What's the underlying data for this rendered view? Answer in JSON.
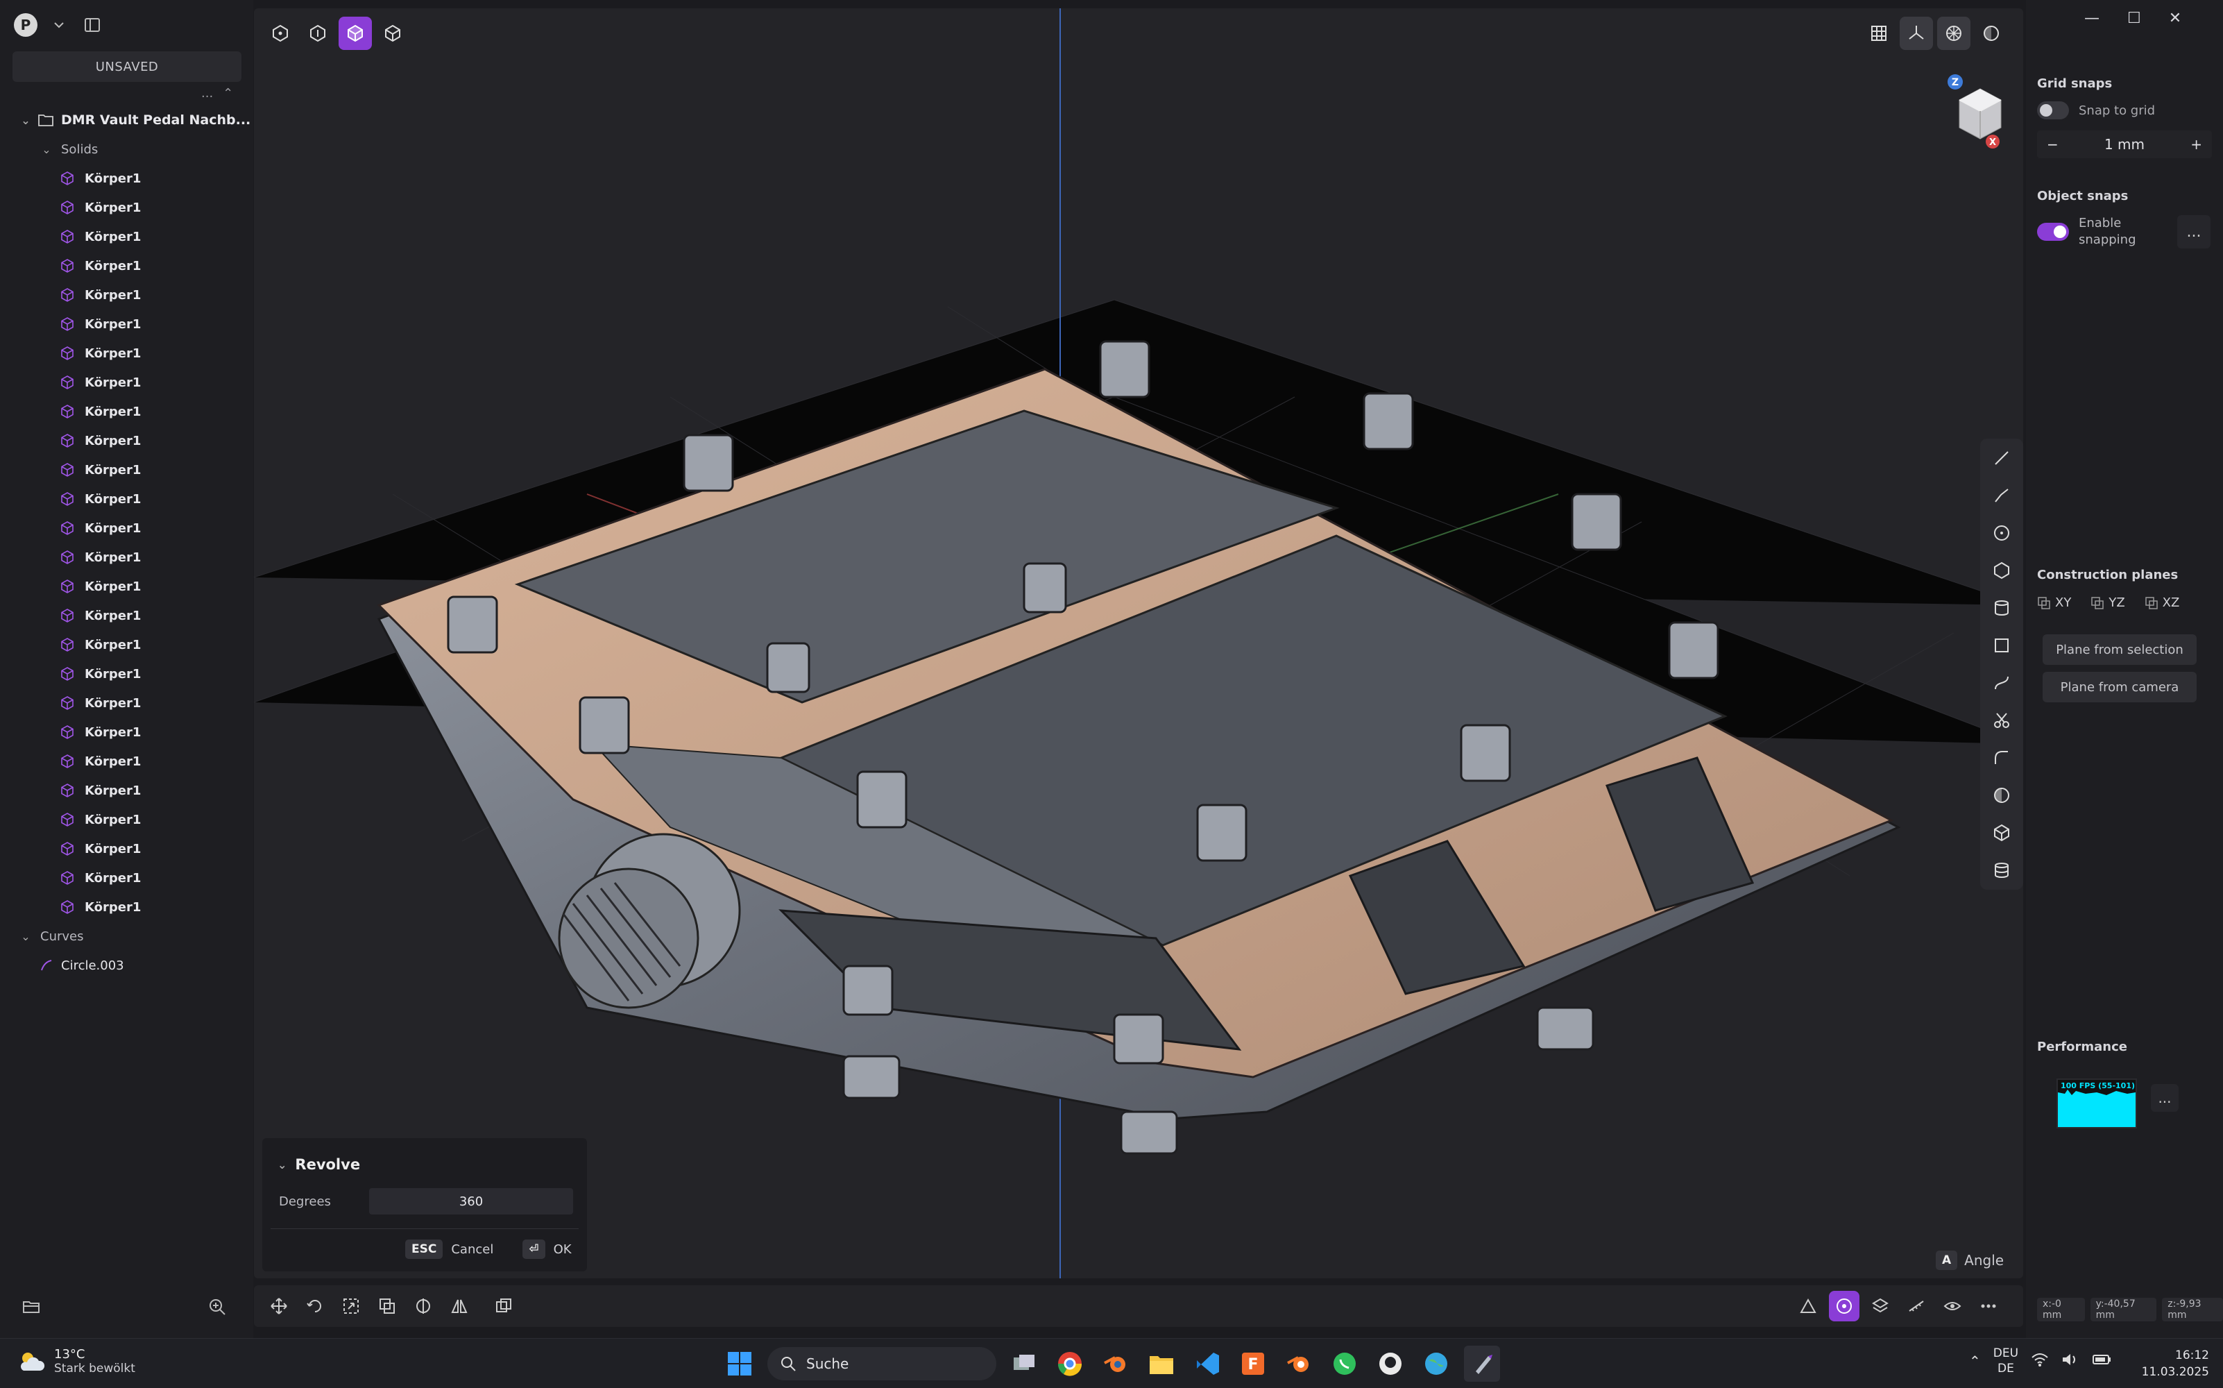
{
  "sidebar": {
    "avatar_letter": "P",
    "unsaved_label": "UNSAVED",
    "more_label": "...",
    "project_name": "DMR Vault Pedal Nachb...",
    "solids_label": "Solids",
    "solids": [
      "Körper1",
      "Körper1",
      "Körper1",
      "Körper1",
      "Körper1",
      "Körper1",
      "Körper1",
      "Körper1",
      "Körper1",
      "Körper1",
      "Körper1",
      "Körper1",
      "Körper1",
      "Körper1",
      "Körper1",
      "Körper1",
      "Körper1",
      "Körper1",
      "Körper1",
      "Körper1",
      "Körper1",
      "Körper1",
      "Körper1",
      "Körper1",
      "Körper1",
      "Körper1"
    ],
    "curves_label": "Curves",
    "curves": [
      "Circle.003"
    ]
  },
  "revolve": {
    "title": "Revolve",
    "degrees_label": "Degrees",
    "degrees_value": "360",
    "cancel_key": "ESC",
    "cancel_label": "Cancel",
    "ok_key": "⏎",
    "ok_label": "OK"
  },
  "angle": {
    "key": "A",
    "label": "Angle"
  },
  "right_panel": {
    "grid_snaps_title": "Grid snaps",
    "snap_to_grid_label": "Snap to grid",
    "snap_to_grid_on": false,
    "grid_size_value": "1 mm",
    "minus_label": "−",
    "plus_label": "+",
    "object_snaps_title": "Object snaps",
    "enable_snapping_label_1": "Enable",
    "enable_snapping_label_2": "snapping",
    "enable_snapping_on": true,
    "more_label": "...",
    "construction_planes_title": "Construction planes",
    "planes": [
      "XY",
      "YZ",
      "XZ"
    ],
    "plane_from_selection": "Plane from selection",
    "plane_from_camera": "Plane from camera",
    "performance_title": "Performance",
    "fps_label": "100 FPS (55-101)",
    "coord_x": "x:-0 mm",
    "coord_y": "y:-40,57 mm",
    "coord_z": "z:-9,93 mm"
  },
  "navcube": {
    "z_label": "Z",
    "x_label": "X"
  },
  "taskbar": {
    "temperature": "13°C",
    "weather": "Stark bewölkt",
    "search_label": "Suche",
    "lang_1": "DEU",
    "lang_2": "DE",
    "time": "16:12",
    "date": "11.03.2025"
  },
  "colors": {
    "accent": "#8a3dd6",
    "solid_icon": "#a056e8",
    "fps_graph": "#00e5ff"
  }
}
